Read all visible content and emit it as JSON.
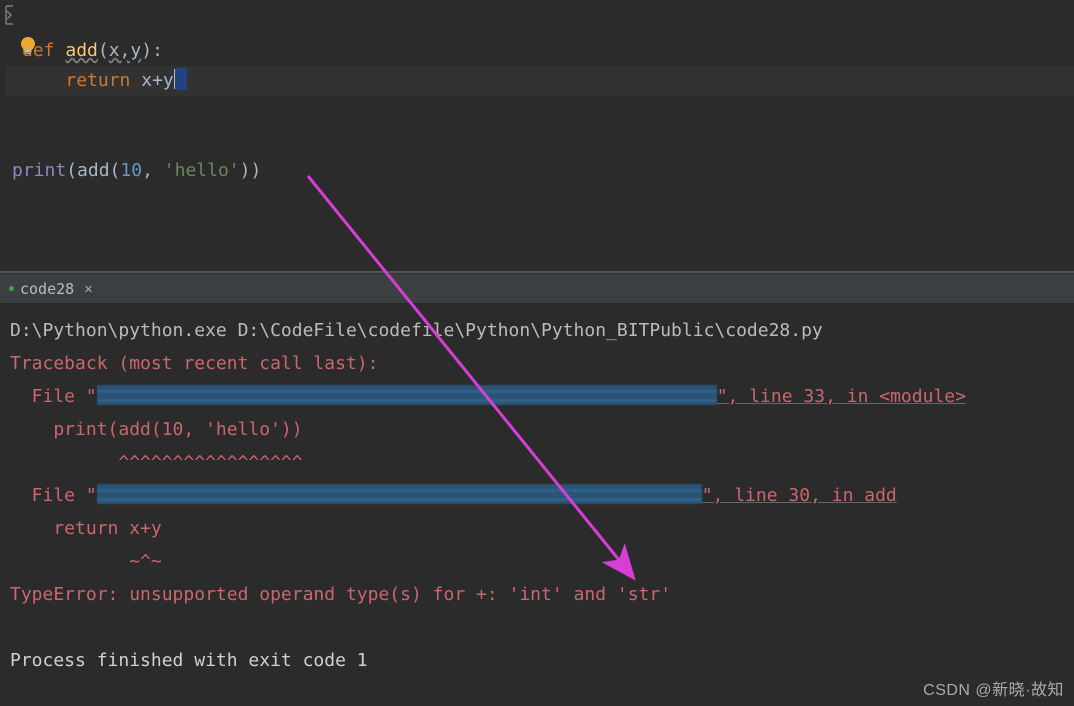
{
  "editor": {
    "line1": {
      "def": "def",
      "fn": "add",
      "open": "(",
      "params": "x,y",
      "close": "):"
    },
    "line2": {
      "ret": "return",
      "expr_x": "x",
      "expr_op": "+",
      "expr_y": "y"
    },
    "line4": {
      "print": "print",
      "open": "(",
      "call": "add",
      "open2": "(",
      "n": "10",
      "comma": ", ",
      "s": "'hello'",
      "close2": ")",
      "close": ")"
    }
  },
  "tab": {
    "name": "code28"
  },
  "console": {
    "path": "D:\\Python\\python.exe D:\\CodeFile\\codefile\\Python\\Python_BITPublic\\code28.py",
    "traceback": "Traceback (most recent call last):",
    "file1a": "  File \"",
    "file1b": "\", line 33, in <module>",
    "call1": "    print(add(10, 'hello'))",
    "caret1": "          ^^^^^^^^^^^^^^^^^",
    "file2a": "  File \"",
    "file2b": "\", line 30, in add",
    "call2": "    return x+y",
    "caret2": "           ~^~",
    "err": "TypeError: unsupported operand type(s) for +: 'int' and 'str'",
    "exit": "Process finished with exit code 1"
  },
  "watermark": "CSDN @新晓·故知"
}
